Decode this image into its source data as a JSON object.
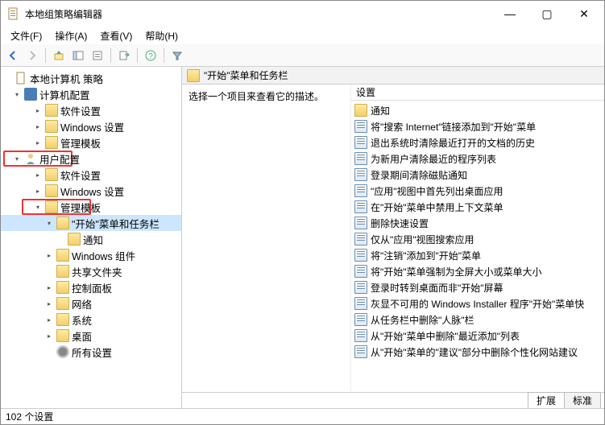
{
  "window": {
    "title": "本地组策略编辑器"
  },
  "menubar": {
    "file": "文件(F)",
    "action": "操作(A)",
    "view": "查看(V)",
    "help": "帮助(H)"
  },
  "tree": {
    "root": "本地计算机 策略",
    "computer_config": "计算机配置",
    "cc_software": "软件设置",
    "cc_windows": "Windows 设置",
    "cc_admin": "管理模板",
    "user_config": "用户配置",
    "uc_software": "软件设置",
    "uc_windows": "Windows 设置",
    "uc_admin": "管理模板",
    "start_taskbar": "\"开始\"菜单和任务栏",
    "notifications": "通知",
    "win_components": "Windows 组件",
    "shared_folders": "共享文件夹",
    "control_panel": "控制面板",
    "network": "网络",
    "system": "系统",
    "desktop": "桌面",
    "all_settings": "所有设置"
  },
  "right": {
    "header": "\"开始\"菜单和任务栏",
    "desc": "选择一个项目来查看它的描述。",
    "col_setting": "设置",
    "items": [
      {
        "type": "folder",
        "label": "通知"
      },
      {
        "type": "setting",
        "label": "将\"搜索 Internet\"链接添加到\"开始\"菜单"
      },
      {
        "type": "setting",
        "label": "退出系统时清除最近打开的文档的历史"
      },
      {
        "type": "setting",
        "label": "为新用户清除最近的程序列表"
      },
      {
        "type": "setting",
        "label": "登录期间清除磁贴通知"
      },
      {
        "type": "setting",
        "label": "\"应用\"视图中首先列出桌面应用"
      },
      {
        "type": "setting",
        "label": "在\"开始\"菜单中禁用上下文菜单"
      },
      {
        "type": "setting",
        "label": "删除快速设置"
      },
      {
        "type": "setting",
        "label": "仅从\"应用\"视图搜索应用"
      },
      {
        "type": "setting",
        "label": "将\"注销\"添加到\"开始\"菜单"
      },
      {
        "type": "setting",
        "label": "将\"开始\"菜单强制为全屏大小或菜单大小"
      },
      {
        "type": "setting",
        "label": "登录时转到桌面而非\"开始\"屏幕"
      },
      {
        "type": "setting",
        "label": "灰显不可用的 Windows Installer 程序\"开始\"菜单快"
      },
      {
        "type": "setting",
        "label": "从任务栏中删除\"人脉\"栏"
      },
      {
        "type": "setting",
        "label": "从\"开始\"菜单中删除\"最近添加\"列表"
      },
      {
        "type": "setting",
        "label": "从\"开始\"菜单的\"建议\"部分中删除个性化网站建议"
      }
    ]
  },
  "tabs": {
    "extended": "扩展",
    "standard": "标准"
  },
  "status": "102 个设置"
}
